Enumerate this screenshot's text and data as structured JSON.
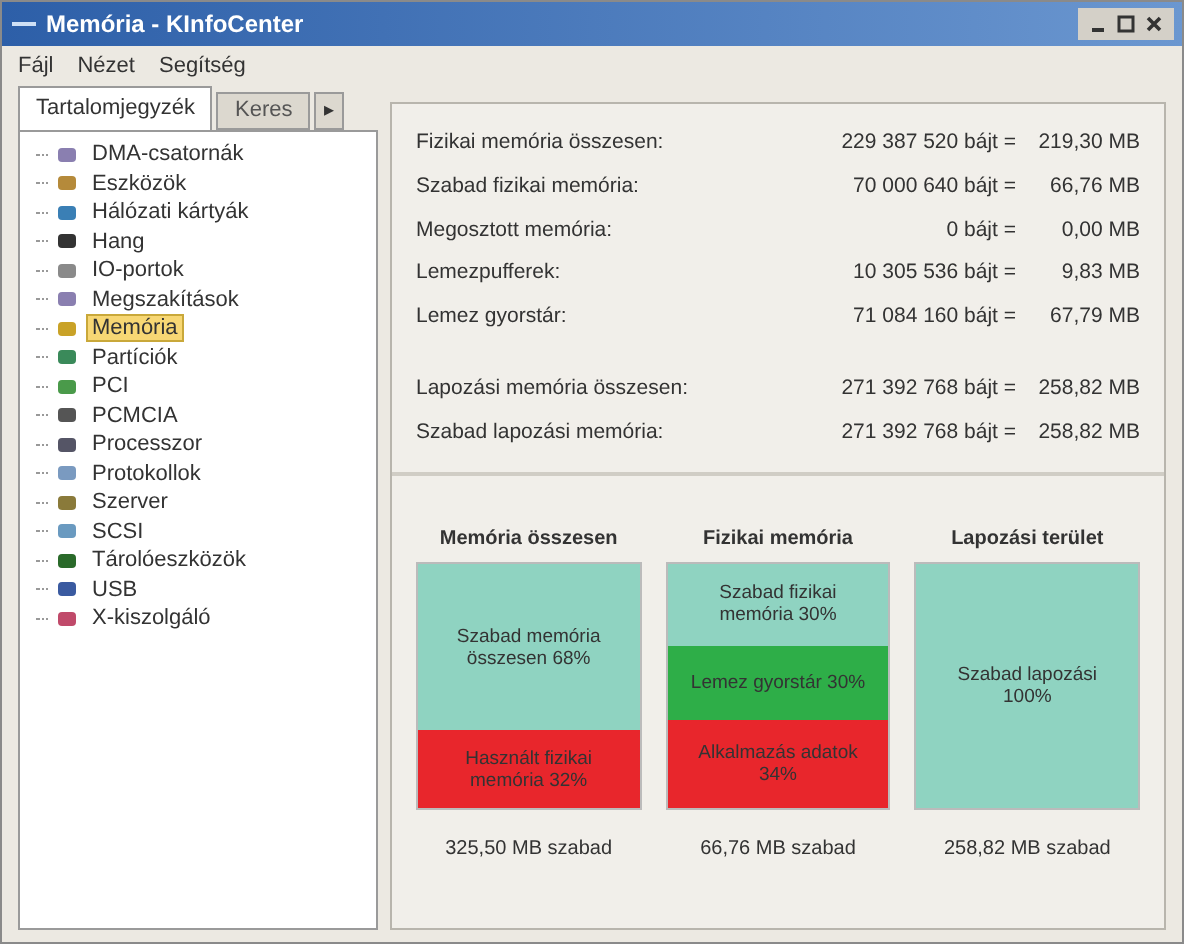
{
  "window": {
    "title": "Memória - KInfoCenter"
  },
  "menu": [
    "Fájl",
    "Nézet",
    "Segítség"
  ],
  "sidebar": {
    "tabs": [
      {
        "label": "Tartalomjegyzék",
        "selected": true
      },
      {
        "label": "Keres",
        "selected": false
      }
    ],
    "scroll_tab": "▸",
    "items": [
      {
        "label": "DMA-csatornák",
        "selected": false
      },
      {
        "label": "Eszközök",
        "selected": false
      },
      {
        "label": "Hálózati kártyák",
        "selected": false
      },
      {
        "label": "Hang",
        "selected": false
      },
      {
        "label": "IO-portok",
        "selected": false
      },
      {
        "label": "Megszakítások",
        "selected": false
      },
      {
        "label": "Memória",
        "selected": true
      },
      {
        "label": "Partíciók",
        "selected": false
      },
      {
        "label": "PCI",
        "selected": false
      },
      {
        "label": "PCMCIA",
        "selected": false
      },
      {
        "label": "Processzor",
        "selected": false
      },
      {
        "label": "Protokollok",
        "selected": false
      },
      {
        "label": "Szerver",
        "selected": false
      },
      {
        "label": "SCSI",
        "selected": false
      },
      {
        "label": "Tárolóeszközök",
        "selected": false
      },
      {
        "label": "USB",
        "selected": false
      },
      {
        "label": "X-kiszolgáló",
        "selected": false
      }
    ]
  },
  "memory_info": [
    [
      {
        "label": "Fizikai memória összesen:",
        "bytes": "229 387 520 bájt =",
        "mb": "219,30 MB"
      },
      {
        "label": "Szabad fizikai memória:",
        "bytes": "70 000 640 bájt =",
        "mb": "66,76 MB"
      },
      {
        "label": "Megosztott memória:",
        "bytes": "0 bájt =",
        "mb": "0,00 MB"
      },
      {
        "label": "Lemezpufferek:",
        "bytes": "10 305 536 bájt =",
        "mb": "9,83 MB"
      },
      {
        "label": "Lemez gyorstár:",
        "bytes": "71 084 160 bájt =",
        "mb": "67,79 MB"
      }
    ],
    [
      {
        "label": "Lapozási memória összesen:",
        "bytes": "271 392 768 bájt =",
        "mb": "258,82 MB"
      },
      {
        "label": "Szabad lapozási memória:",
        "bytes": "271 392 768 bájt =",
        "mb": "258,82 MB"
      }
    ]
  ],
  "charts": [
    {
      "title": "Memória összesen",
      "footer": "325,50 MB szabad",
      "segments": [
        {
          "label": "Szabad memória összesen 68%",
          "color": "#8fd3c1"
        },
        {
          "label": "Használt fizikai memória 32%",
          "color": "#e8262c"
        }
      ]
    },
    {
      "title": "Fizikai memória",
      "footer": "66,76 MB szabad",
      "segments": [
        {
          "label": "Szabad fizikai memória 30%",
          "color": "#8fd3c1"
        },
        {
          "label": "Lemez gyorstár 30%",
          "color": "#2eae48"
        },
        {
          "label": "Alkalmazás adatok 34%",
          "color": "#e8262c"
        }
      ]
    },
    {
      "title": "Lapozási terület",
      "footer": "258,82 MB szabad",
      "segments": [
        {
          "label": "Szabad lapozási 100%",
          "color": "#8fd3c1"
        }
      ]
    }
  ]
}
